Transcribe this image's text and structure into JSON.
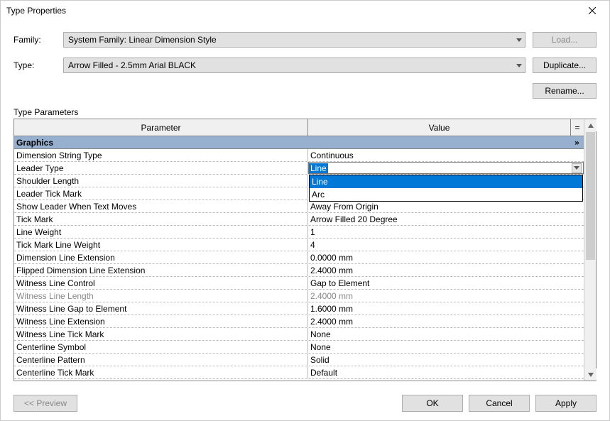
{
  "dialog": {
    "title": "Type Properties"
  },
  "labels": {
    "family": "Family:",
    "type": "Type:",
    "typeParams": "Type Parameters"
  },
  "combos": {
    "family": "System Family: Linear Dimension Style",
    "type": "Arrow Filled - 2.5mm Arial BLACK"
  },
  "buttons": {
    "load": "Load...",
    "duplicate": "Duplicate...",
    "rename": "Rename...",
    "preview": "<< Preview",
    "ok": "OK",
    "cancel": "Cancel",
    "apply": "Apply"
  },
  "gridHeader": {
    "parameter": "Parameter",
    "value": "Value",
    "eq": "="
  },
  "group": {
    "graphics": "Graphics"
  },
  "dropdown": {
    "selected": "Line",
    "options": [
      "Line",
      "Arc"
    ]
  },
  "rows": [
    {
      "param": "Dimension String Type",
      "value": "Continuous"
    },
    {
      "param": "Leader Type",
      "value": "Line",
      "active": true
    },
    {
      "param": "Shoulder Length",
      "value": ""
    },
    {
      "param": "Leader Tick Mark",
      "value": ""
    },
    {
      "param": "Show Leader When Text Moves",
      "value": "Away From Origin"
    },
    {
      "param": "Tick Mark",
      "value": "Arrow Filled 20 Degree"
    },
    {
      "param": "Line Weight",
      "value": "1"
    },
    {
      "param": "Tick Mark Line Weight",
      "value": "4"
    },
    {
      "param": "Dimension Line Extension",
      "value": "0.0000 mm"
    },
    {
      "param": "Flipped Dimension Line Extension",
      "value": "2.4000 mm"
    },
    {
      "param": "Witness Line Control",
      "value": "Gap to Element"
    },
    {
      "param": "Witness Line Length",
      "value": "2.4000 mm",
      "disabled": true
    },
    {
      "param": "Witness Line Gap to Element",
      "value": "1.6000 mm"
    },
    {
      "param": "Witness Line Extension",
      "value": "2.4000 mm"
    },
    {
      "param": "Witness Line Tick Mark",
      "value": "None"
    },
    {
      "param": "Centerline Symbol",
      "value": "None"
    },
    {
      "param": "Centerline Pattern",
      "value": "Solid"
    },
    {
      "param": "Centerline Tick Mark",
      "value": "Default"
    }
  ]
}
